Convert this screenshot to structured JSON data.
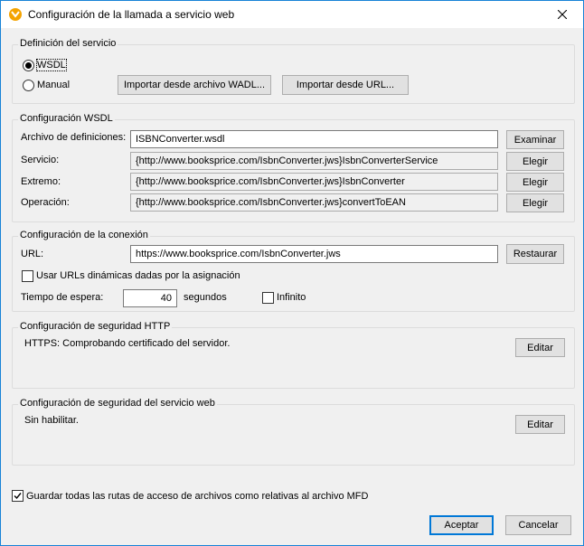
{
  "window": {
    "title": "Configuración de la llamada a servicio web",
    "app_icon": "mapforce-logo-icon",
    "close_icon": "close-icon"
  },
  "service_definition": {
    "label": "Definición del servicio",
    "options": [
      {
        "label": "WSDL",
        "selected": true
      },
      {
        "label": "Manual",
        "selected": false
      }
    ],
    "import_wadl_label": "Importar desde archivo WADL...",
    "import_url_label": "Importar desde URL..."
  },
  "wsdl_config": {
    "label": "Configuración WSDL",
    "definitions_label": "Archivo de definiciones:",
    "definitions_value": "ISBNConverter.wsdl",
    "browse_label": "Examinar",
    "service_label": "Servicio:",
    "service_value": "{http://www.booksprice.com/IsbnConverter.jws}IsbnConverterService",
    "endpoint_label": "Extremo:",
    "endpoint_value": "{http://www.booksprice.com/IsbnConverter.jws}IsbnConverter",
    "operation_label": "Operación:",
    "operation_value": "{http://www.booksprice.com/IsbnConverter.jws}convertToEAN",
    "choose_label": "Elegir"
  },
  "connection": {
    "label": "Configuración de la conexión",
    "url_label": "URL:",
    "url_value": "https://www.booksprice.com/IsbnConverter.jws",
    "restore_label": "Restaurar",
    "dynamic_urls_label": "Usar URLs dinámicas dadas por la asignación",
    "dynamic_urls_checked": false,
    "timeout_label": "Tiempo de espera:",
    "timeout_value": "40",
    "timeout_unit": "segundos",
    "infinite_label": "Infinito",
    "infinite_checked": false
  },
  "http_security": {
    "label": "Configuración de seguridad HTTP",
    "status": "HTTPS: Comprobando certificado del servidor.",
    "edit_label": "Editar"
  },
  "ws_security": {
    "label": "Configuración de seguridad del servicio web",
    "status": "Sin habilitar.",
    "edit_label": "Editar"
  },
  "relative_paths": {
    "label": "Guardar todas las rutas de acceso de archivos como relativas al archivo MFD",
    "checked": true
  },
  "footer": {
    "ok_label": "Aceptar",
    "cancel_label": "Cancelar"
  },
  "colors": {
    "accent": "#0078d7",
    "window_border": "#1883d7",
    "dialog_bg": "#f0f0f0",
    "app_icon": "#f4a300"
  }
}
